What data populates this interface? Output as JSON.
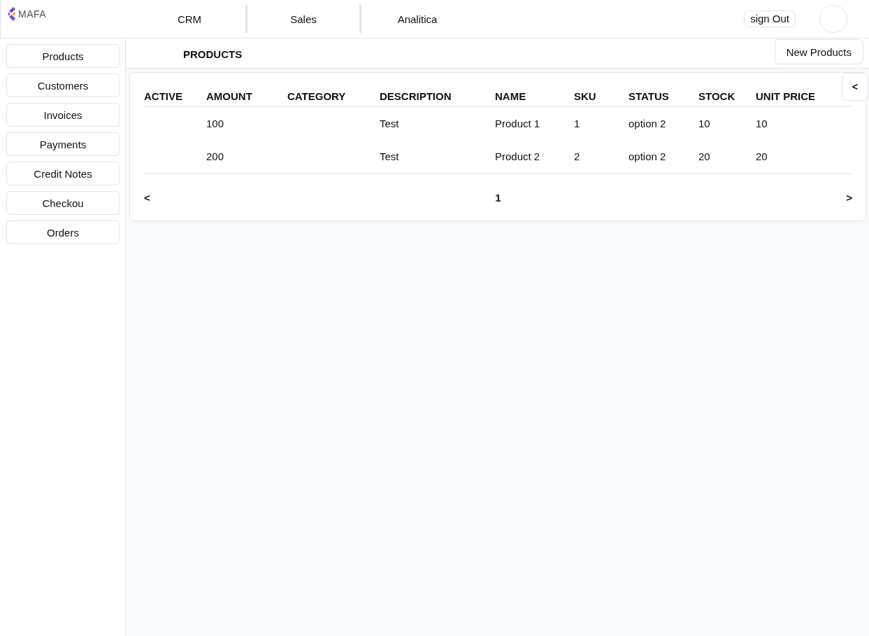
{
  "brand": {
    "name": "MAFA"
  },
  "top_nav": {
    "items": [
      {
        "label": "CRM"
      },
      {
        "label": "Sales"
      },
      {
        "label": "Analitica"
      }
    ],
    "sign_out": "sign Out"
  },
  "sidebar": {
    "items": [
      {
        "label": "Products"
      },
      {
        "label": "Customers"
      },
      {
        "label": "Invoices"
      },
      {
        "label": "Payments"
      },
      {
        "label": "Credit Notes"
      },
      {
        "label": "Checkou"
      },
      {
        "label": "Orders"
      }
    ]
  },
  "page_header": {
    "title": "PRODUCTS",
    "action": "New Products"
  },
  "table": {
    "collapse_button": "<",
    "columns": [
      "ACTIVE",
      "AMOUNT",
      "CATEGORY",
      "DESCRIPTION",
      "NAME",
      "SKU",
      "STATUS",
      "STOCK",
      "UNIT PRICE"
    ],
    "rows": [
      {
        "cells": [
          null,
          "100",
          null,
          "Test",
          "Product 1",
          "1",
          "option 2",
          "10",
          "10"
        ]
      },
      {
        "cells": [
          null,
          "200",
          null,
          "Test",
          "Product 2",
          "2",
          "option 2",
          "20",
          "20"
        ]
      }
    ],
    "pagination": {
      "previous": "<",
      "page": "1",
      "next": ">"
    }
  }
}
